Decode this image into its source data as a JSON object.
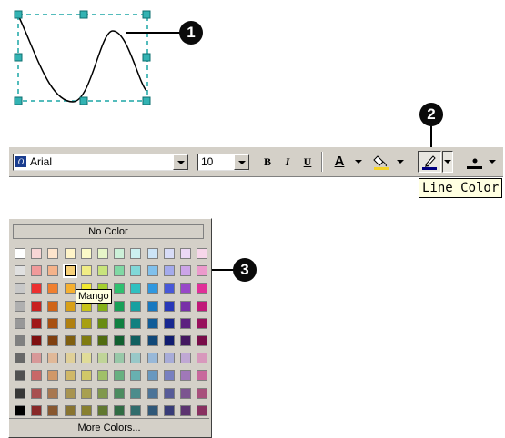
{
  "callouts": [
    "1",
    "2",
    "3"
  ],
  "toolbar": {
    "font_name": "Arial",
    "font_size": "10",
    "bold_label": "B",
    "italic_label": "I",
    "underline_label": "U",
    "font_color_label": "A",
    "accent_color": "#000080"
  },
  "tooltip": {
    "line_color": "Line Color"
  },
  "palette": {
    "no_color_label": "No Color",
    "more_colors_label": "More Colors...",
    "hover_tooltip": "Mango",
    "selected_swatch": "Mango",
    "rows": [
      [
        "#ffffff",
        "#f7d6d6",
        "#fde4cc",
        "#fff4c8",
        "#fbfac8",
        "#e6f5c8",
        "#ccf0d8",
        "#ccf0f0",
        "#cce4f7",
        "#d8dcf7",
        "#ecd8f5",
        "#f7d6ea"
      ],
      [
        "#e0e0e0",
        "#f09a9a",
        "#f5b38a",
        "#f7d17a",
        "#f0ec84",
        "#c8e47c",
        "#80d8a4",
        "#80d8d8",
        "#80c0ec",
        "#a4aaec",
        "#cca4e8",
        "#ec9acc"
      ],
      [
        "#c8c8c8",
        "#ec3030",
        "#f08030",
        "#f5b030",
        "#f0e830",
        "#a4d030",
        "#30c070",
        "#30c0c0",
        "#3098e0",
        "#4858d8",
        "#9848c8",
        "#e03098"
      ],
      [
        "#b0b0b0",
        "#c82020",
        "#d06418",
        "#d8a018",
        "#c8c418",
        "#84b018",
        "#18a058",
        "#18a0a0",
        "#1878c0",
        "#2838b8",
        "#7830a8",
        "#c01878"
      ],
      [
        "#989898",
        "#a01818",
        "#a85010",
        "#b08010",
        "#a8a010",
        "#688c10",
        "#108040",
        "#108080",
        "#105c98",
        "#182890",
        "#5c2080",
        "#98105c"
      ],
      [
        "#808080",
        "#801010",
        "#804010",
        "#806010",
        "#807c10",
        "#506c10",
        "#106030",
        "#106060",
        "#104878",
        "#101c70",
        "#441860",
        "#780c48"
      ],
      [
        "#686868",
        "#d89898",
        "#e0b898",
        "#e0d098",
        "#e0dc98",
        "#c0d498",
        "#98c8a8",
        "#98c8c8",
        "#98b8d8",
        "#a8acd8",
        "#c0a8d4",
        "#d898bc"
      ],
      [
        "#505050",
        "#c86868",
        "#d09868",
        "#d0b868",
        "#d0c868",
        "#a0c068",
        "#68b080",
        "#68b0b0",
        "#6898c0",
        "#7880c0",
        "#a078b8",
        "#c8689c"
      ],
      [
        "#383838",
        "#a85050",
        "#a87850",
        "#a89450",
        "#a8a050",
        "#80984c",
        "#4c8c60",
        "#4c8c8c",
        "#4c7498",
        "#585c98",
        "#7c5490",
        "#a8507c"
      ],
      [
        "#000000",
        "#882828",
        "#885830",
        "#887430",
        "#888030",
        "#607830",
        "#306c44",
        "#306c6c",
        "#305878",
        "#383c78",
        "#5c3470",
        "#883060"
      ]
    ]
  }
}
